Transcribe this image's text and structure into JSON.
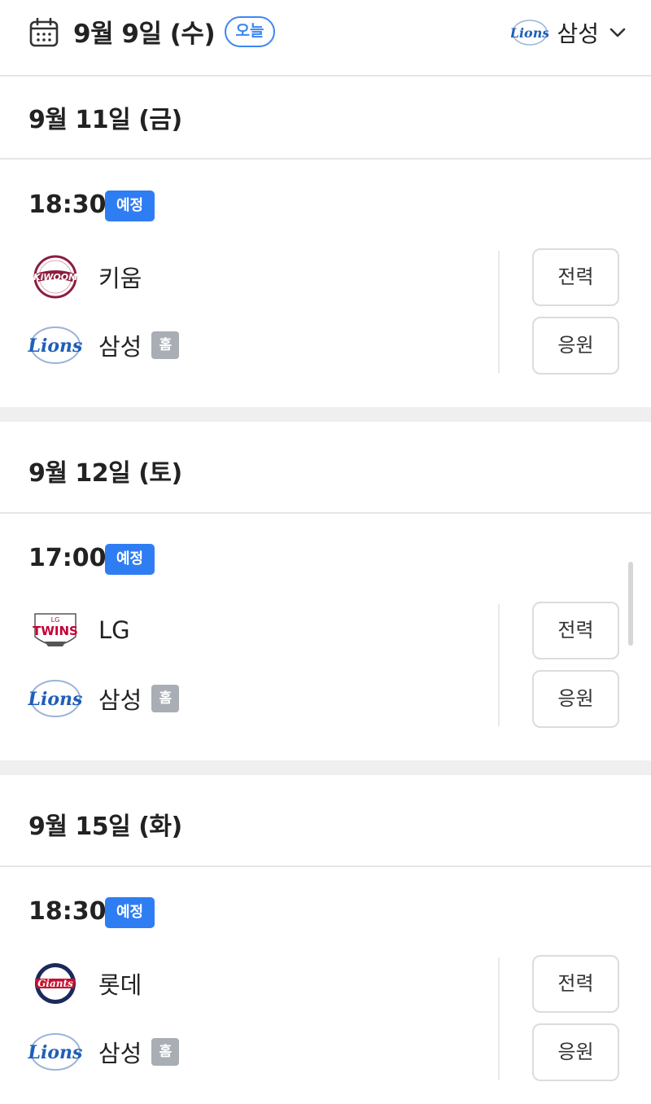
{
  "header": {
    "today_date": "9월 9일 (수)",
    "today_badge": "오늘",
    "selected_team": "삼성",
    "icons": {
      "calendar": "calendar-icon",
      "dropdown": "chevron-down-icon"
    }
  },
  "labels": {
    "btn_lineup": "전력",
    "btn_cheer": "응원",
    "home": "홈"
  },
  "days": [
    {
      "date": "9월 11일 (금)",
      "time": "18:30",
      "status": "예정",
      "away": {
        "name": "키움",
        "logo": "kiwoom-logo"
      },
      "home": {
        "name": "삼성",
        "logo": "lions-logo"
      }
    },
    {
      "date": "9월 12일 (토)",
      "time": "17:00",
      "status": "예정",
      "away": {
        "name": "LG",
        "logo": "lg-twins-logo"
      },
      "home": {
        "name": "삼성",
        "logo": "lions-logo"
      }
    },
    {
      "date": "9월 15일 (화)",
      "time": "18:30",
      "status": "예정",
      "away": {
        "name": "롯데",
        "logo": "lotte-giants-logo"
      },
      "home": {
        "name": "삼성",
        "logo": "lions-logo"
      }
    }
  ],
  "colors": {
    "accent": "#2f7df3",
    "home_badge": "#a9aeb5",
    "separator": "#efefef",
    "lions_blue": "#1f5fb8",
    "kiwoom_red": "#8c1d3f",
    "twins_red": "#c30037",
    "giants_navy": "#1a2a5c"
  },
  "logo_texts": {
    "lions": "Lions",
    "kiwoom": "KiWOOM",
    "twins_small": "LG",
    "twins": "TWINS",
    "giants": "Giants"
  }
}
